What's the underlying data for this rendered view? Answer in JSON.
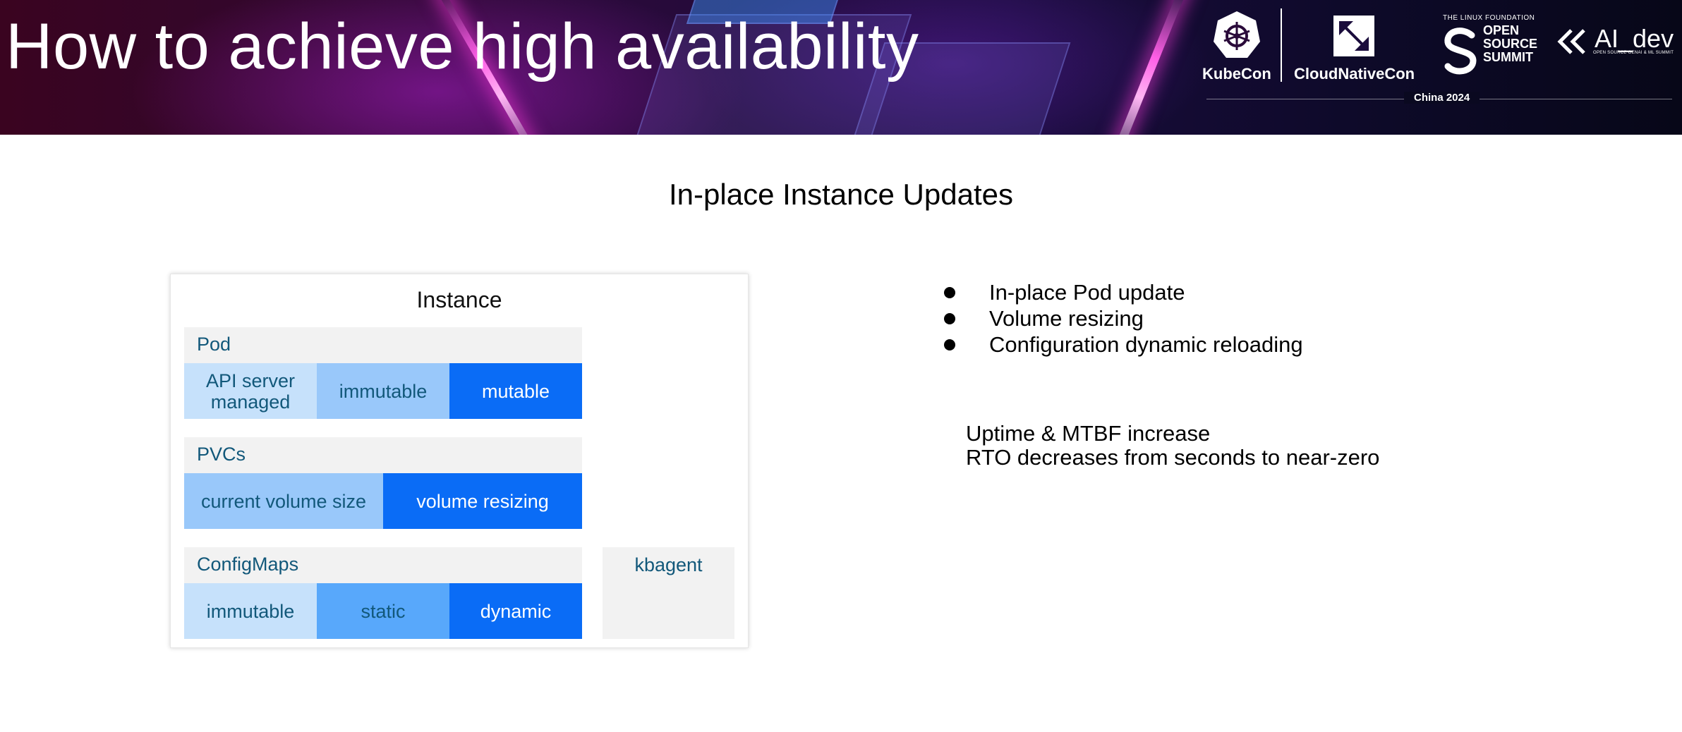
{
  "header": {
    "title": "How to achieve high availability",
    "logos": {
      "kubecon": "KubeCon",
      "cloudnativecon": "CloudNativeCon",
      "linux_foundation": "THE LINUX FOUNDATION",
      "oss_line1": "OPEN",
      "oss_line2": "SOURCE",
      "oss_line3": "SUMMIT",
      "ai_dev": "AI_dev",
      "ai_dev_sub": "OPEN SOURCE GENAI & ML SUMMIT",
      "event": "China 2024"
    }
  },
  "subtitle": "In-place Instance Updates",
  "diagram": {
    "title": "Instance",
    "pod": {
      "label": "Pod",
      "cells": [
        "API server managed",
        "immutable",
        "mutable"
      ]
    },
    "pvcs": {
      "label": "PVCs",
      "cells": [
        "current volume size",
        "volume resizing"
      ]
    },
    "configmaps": {
      "label": "ConfigMaps",
      "cells": [
        "immutable",
        "static",
        "dynamic"
      ]
    },
    "agent": {
      "label": "kbagent"
    }
  },
  "bullets": [
    "In-place Pod update",
    "Volume resizing",
    "Configuration dynamic reloading"
  ],
  "summary": {
    "line1": "Uptime & MTBF increase",
    "line2": "RTO decreases from seconds to near-zero"
  },
  "colors": {
    "light": "#c6e1fb",
    "mid": "#99c8fa",
    "mid2": "#58a8fb",
    "strong": "#0a6cf6",
    "section_bg": "#f2f2f2",
    "label_text": "#12587a"
  }
}
